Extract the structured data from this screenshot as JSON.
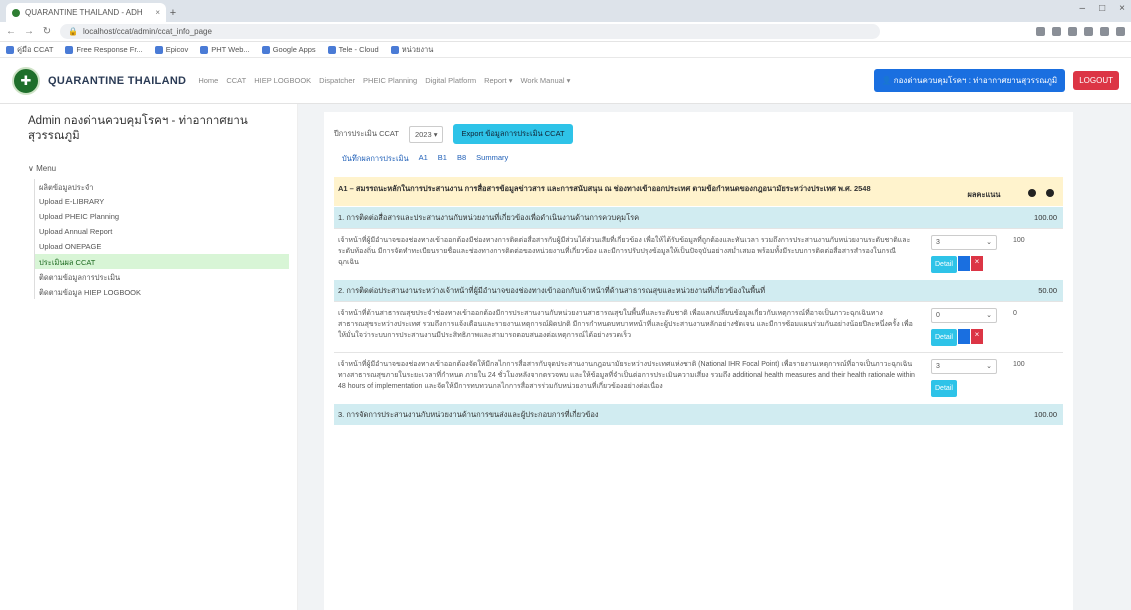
{
  "browser": {
    "tab_title": "QUARANTINE THAILAND - ADH",
    "close": "×",
    "newtab": "+",
    "url": "localhost/ccat/admin/ccat_info_page",
    "window": [
      "–",
      "□",
      "×"
    ],
    "bookmarks": [
      "คู่มือ CCAT",
      "Free Response Fr...",
      "Epicov",
      "PHT Web...",
      "Google Apps",
      "Tele - Cloud",
      "หน่วยงาน"
    ]
  },
  "navbar": {
    "brand": "QUARANTINE THAILAND",
    "menu": [
      "Home",
      "CCAT",
      "HIEP LOGBOOK",
      "Dispatcher",
      "PHEIC Planning",
      "Digital Platform",
      "Report ▾",
      "Work Manual ▾"
    ],
    "user_label": "กองด่านควบคุมโรคฯ : ท่าอากาศยานสุวรรณภูมิ",
    "logout": "LOGOUT"
  },
  "sidebar": {
    "title": "Admin กองด่านควบคุมโรคฯ - ท่าอากาศยานสุวรรณภูมิ",
    "menu_label": "∨ Menu",
    "items": [
      "ผลิตข้อมูลประจำ",
      "Upload E-LIBRARY",
      "Upload PHEIC Planning",
      "Upload Annual Report",
      "Upload ONEPAGE",
      "ประเมินผล CCAT",
      "ติดตามข้อมูลการประเมิน",
      "ติดตามข้อมูล HIEP LOGBOOK"
    ]
  },
  "main": {
    "year_label": "ปีการประเมิน CCAT",
    "year": "2023",
    "export_button": "Export ข้อมูลการประเมิน CCAT",
    "tabs": [
      "บันทึกผลการประเมิน",
      "A1",
      "B1",
      "B8",
      "Summary"
    ],
    "header": {
      "title": "A1 – สมรรถนะหลักในการประสานงาน การสื่อสารข้อมูลข่าวสาร และการสนับสนุน ณ ช่องทางเข้าออกประเทศ ตามข้อกำหนดของกฎอนามัยระหว่างประเทศ พ.ศ. 2548",
      "score_col": "ผลคะแนน",
      "icons": [
        "info-icon",
        "info-icon"
      ]
    },
    "sections": [
      {
        "title": "1. การติดต่อสื่อสารและประสานงานกับหน่วยงานที่เกี่ยวข้องเพื่อดำเนินงานด้านการควบคุมโรค",
        "score": "100.00",
        "rows": [
          {
            "text": "เจ้าหน้าที่ผู้มีอำนาจของช่องทางเข้าออกต้องมีช่องทางการติดต่อสื่อสารกับผู้มีส่วนได้ส่วนเสียที่เกี่ยวข้อง เพื่อให้ได้รับข้อมูลที่ถูกต้องและทันเวลา รวมถึงการประสานงานกับหน่วยงานระดับชาติและระดับท้องถิ่น มีการจัดทำทะเบียนรายชื่อและช่องทางการติดต่อของหน่วยงานที่เกี่ยวข้อง และมีการปรับปรุงข้อมูลให้เป็นปัจจุบันอย่างสม่ำเสมอ พร้อมทั้งมีระบบการติดต่อสื่อสารสำรองในกรณีฉุกเฉิน",
            "select": "3",
            "score": "100",
            "buttons": [
              "Detail",
              "✎",
              "×"
            ]
          }
        ]
      },
      {
        "title": "2. การติดต่อประสานงานระหว่างเจ้าหน้าที่ผู้มีอำนาจของช่องทางเข้าออกกับเจ้าหน้าที่ด้านสาธารณสุขและหน่วยงานที่เกี่ยวข้องในพื้นที่",
        "score": "50.00",
        "rows": [
          {
            "text": "เจ้าหน้าที่ด้านสาธารณสุขประจำช่องทางเข้าออกต้องมีการประสานงานกับหน่วยงานสาธารณสุขในพื้นที่และระดับชาติ เพื่อแลกเปลี่ยนข้อมูลเกี่ยวกับเหตุการณ์ที่อาจเป็นภาวะฉุกเฉินทางสาธารณสุขระหว่างประเทศ รวมถึงการแจ้งเตือนและรายงานเหตุการณ์ผิดปกติ มีการกำหนดบทบาทหน้าที่และผู้ประสานงานหลักอย่างชัดเจน และมีการซ้อมแผนร่วมกันอย่างน้อยปีละหนึ่งครั้ง เพื่อให้มั่นใจว่าระบบการประสานงานมีประสิทธิภาพและสามารถตอบสนองต่อเหตุการณ์ได้อย่างรวดเร็ว",
            "select": "0",
            "score": "0",
            "buttons": [
              "Detail",
              "✎",
              "×"
            ]
          },
          {
            "text": "เจ้าหน้าที่ผู้มีอำนาจของช่องทางเข้าออกต้องจัดให้มีกลไกการสื่อสารกับจุดประสานงานกฎอนามัยระหว่างประเทศแห่งชาติ (National IHR Focal Point) เพื่อรายงานเหตุการณ์ที่อาจเป็นภาวะฉุกเฉินทางสาธารณสุขภายในระยะเวลาที่กำหนด ภายใน 24 ชั่วโมงหลังจากตรวจพบ และให้ข้อมูลที่จำเป็นต่อการประเมินความเสี่ยง รวมถึง additional health measures and their health rationale within 48 hours of implementation และจัดให้มีการทบทวนกลไกการสื่อสารร่วมกับหน่วยงานที่เกี่ยวข้องอย่างต่อเนื่อง",
            "select": "3",
            "score": "100",
            "buttons": [
              "Detail"
            ]
          }
        ]
      },
      {
        "title": "3. การจัดการประสานงานกับหน่วยงานด้านการขนส่งและผู้ประกอบการที่เกี่ยวข้อง",
        "score": "100.00",
        "rows": []
      }
    ]
  },
  "colors": {
    "accent": "#2ec3e8",
    "primary": "#1a6fe0",
    "danger": "#dc3545",
    "header_bg": "#fff3cd",
    "section_bg": "#d1ecf1",
    "active_side": "#d8f5d6"
  }
}
